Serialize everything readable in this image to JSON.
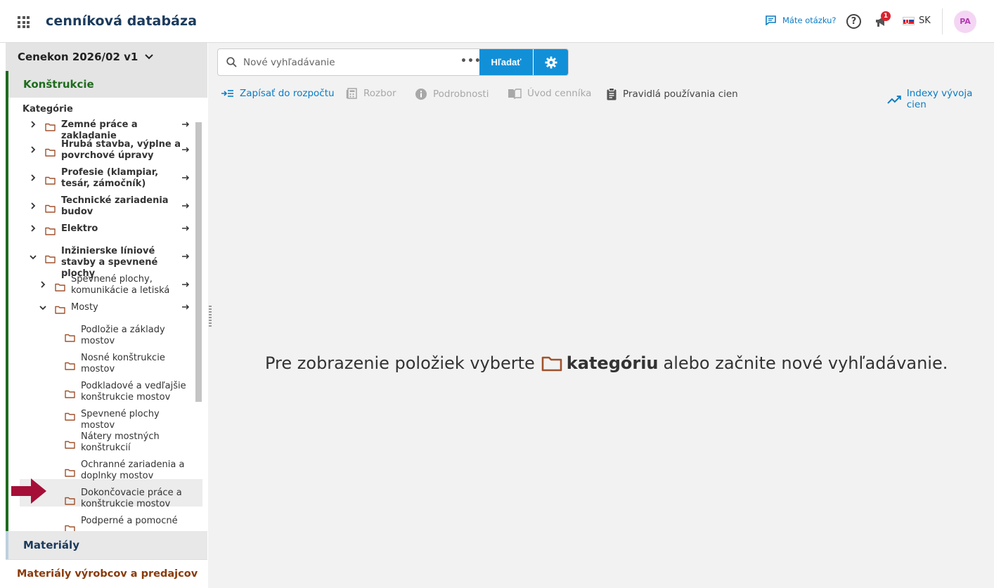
{
  "header": {
    "title": "cenníková databáza",
    "help_label": "Máte otázku?",
    "help_symbol": "?",
    "notification_count": "1",
    "language": "SK",
    "avatar_initials": "PA"
  },
  "sidebar": {
    "version": "Cenekon 2026/02 v1",
    "section_constructions": "Konštrukcie",
    "categories_label": "Kategórie",
    "tree": [
      {
        "label": "Zemné práce a zakladanie",
        "level": 0,
        "expanded": false,
        "bold": true
      },
      {
        "label": "Hrubá stavba, výplne a povrchové úpravy",
        "level": 0,
        "expanded": false,
        "bold": true
      },
      {
        "label": "Profesie (klampiar, tesár, zámočník)",
        "level": 0,
        "expanded": false,
        "bold": true
      },
      {
        "label": "Technické zariadenia budov",
        "level": 0,
        "expanded": false,
        "bold": true
      },
      {
        "label": "Elektro",
        "level": 0,
        "expanded": false,
        "bold": true
      },
      {
        "label": "Inžinierske líniové stavby a spevnené plochy",
        "level": 0,
        "expanded": true,
        "bold": true
      },
      {
        "label": "Spevnené plochy, komunikácie a letiská",
        "level": 1,
        "expanded": false,
        "bold": false
      },
      {
        "label": "Mosty",
        "level": 1,
        "expanded": true,
        "bold": false
      },
      {
        "label": "Podložie a základy mostov",
        "level": 2,
        "bold": false
      },
      {
        "label": "Nosné konštrukcie mostov",
        "level": 2,
        "bold": false
      },
      {
        "label": "Podkladové a vedľajšie konštrukcie mostov",
        "level": 2,
        "bold": false
      },
      {
        "label": "Spevnené plochy mostov",
        "level": 2,
        "bold": false
      },
      {
        "label": "Nátery mostných konštrukcií",
        "level": 2,
        "bold": false,
        "selected": true
      },
      {
        "label": "Ochranné zariadenia a doplnky mostov",
        "level": 2,
        "bold": false
      },
      {
        "label": "Dokončovacie práce a konštrukcie mostov",
        "level": 2,
        "bold": false
      },
      {
        "label": "Podperné a pomocné",
        "level": 2,
        "bold": false
      }
    ],
    "section_materials": "Materiály",
    "section_producers": "Materiály výrobcov a predajcov"
  },
  "search": {
    "placeholder": "Nové vyhľadávanie",
    "more": "•••",
    "button": "Hľadať"
  },
  "toolbar": {
    "write_budget": "Zapísať do rozpočtu",
    "analysis": "Rozbor",
    "details": "Podrobnosti",
    "intro": "Úvod cenníka",
    "rules": "Pravidlá používania cien",
    "indexes": "Indexy vývoja cien"
  },
  "empty_state": {
    "before": "Pre zobrazenie položiek vyberte",
    "keyword": "kategóriu",
    "after": "alebo začnite nové vyhľadávanie."
  },
  "colors": {
    "accent": "#1190d8",
    "green": "#1e6b1e",
    "folder": "#a0522d",
    "arrow": "#a50f37"
  }
}
